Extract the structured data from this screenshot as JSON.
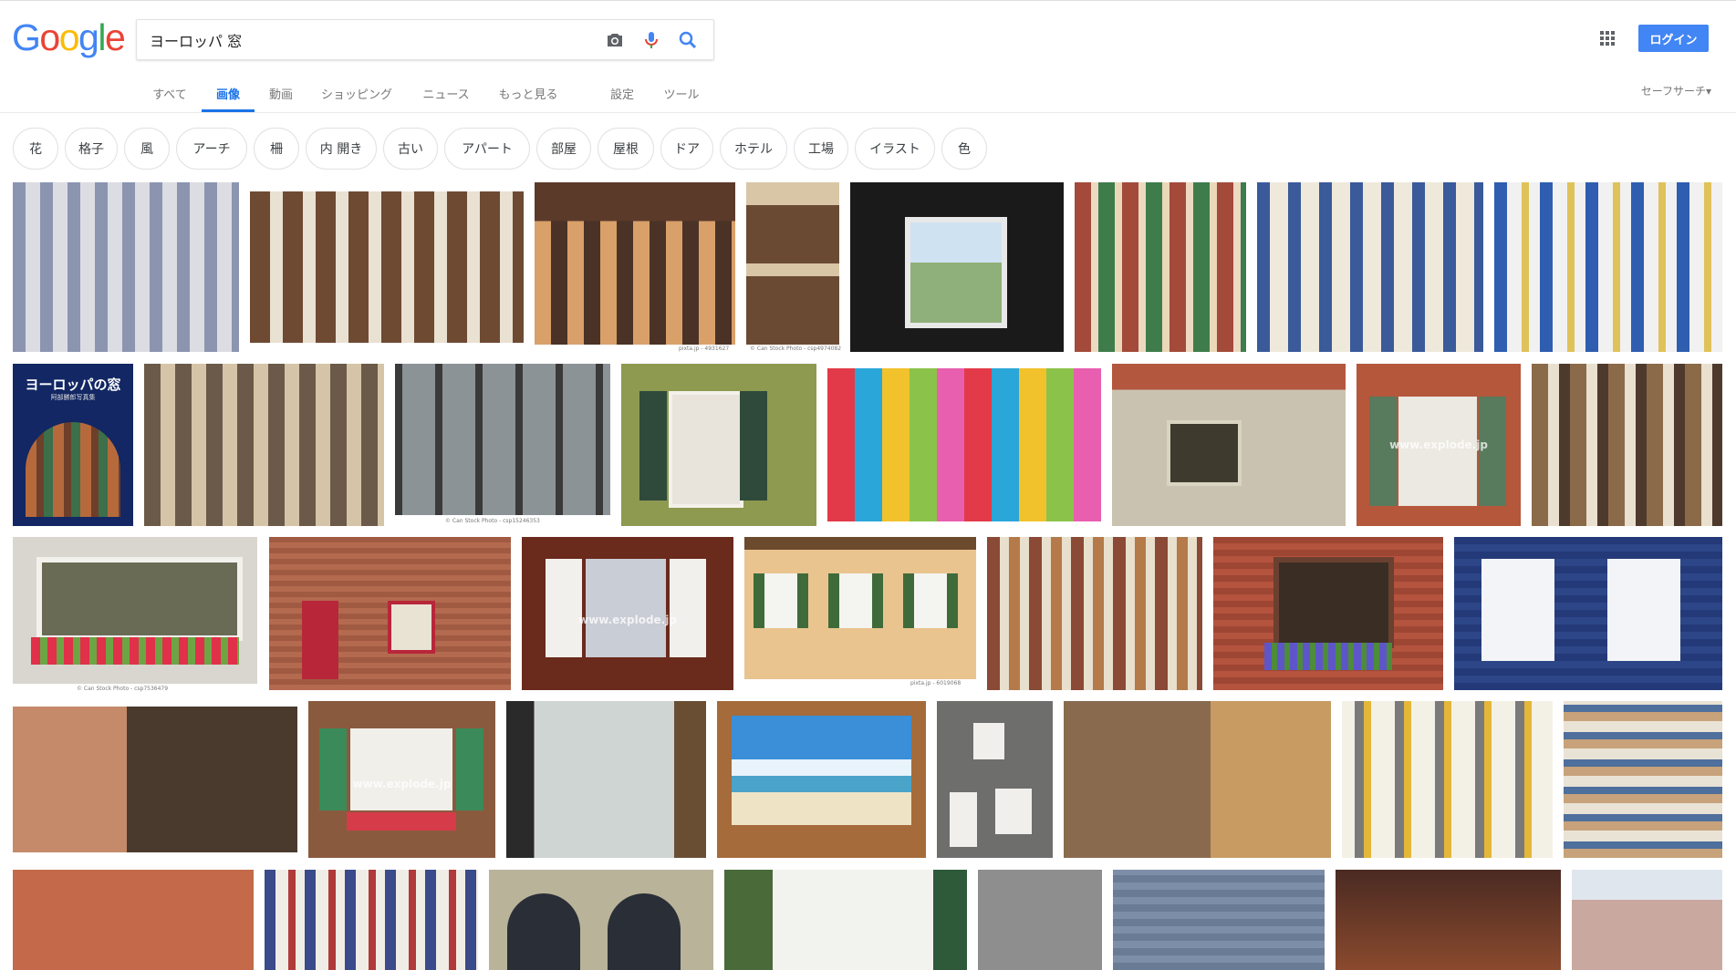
{
  "logo": {
    "letters": [
      "G",
      "o",
      "o",
      "g",
      "l",
      "e"
    ],
    "colors": [
      "#4285f4",
      "#ea4335",
      "#fbbc05",
      "#4285f4",
      "#34a853",
      "#ea4335"
    ]
  },
  "search": {
    "value": "ヨーロッパ 窓"
  },
  "header": {
    "login_label": "ログイン",
    "safesearch_label": "セーフサーチ▾"
  },
  "tabs": [
    {
      "label": "すべて"
    },
    {
      "label": "画像"
    },
    {
      "label": "動画"
    },
    {
      "label": "ショッピング"
    },
    {
      "label": "ニュース"
    },
    {
      "label": "もっと見る"
    },
    {
      "label": "設定"
    },
    {
      "label": "ツール"
    }
  ],
  "active_tab": "画像",
  "chips": [
    "花",
    "格子",
    "風",
    "アーチ",
    "柵",
    "内 開き",
    "古い",
    "アパート",
    "部屋",
    "屋根",
    "ドア",
    "ホテル",
    "工場",
    "イラスト",
    "色"
  ],
  "captions": {
    "pixta1": "pixta.jp - 4931627",
    "canstock1": "© Can Stock Photo - csp4974082",
    "canstock2": "© Can Stock Photo - csp15246353",
    "canstock3": "© Can Stock Photo - csp7536479",
    "pixta2": "pixta.jp - 6019068"
  },
  "book": {
    "title": "ヨーロッパの窓",
    "subtitle": "阿部勝郎写真集"
  },
  "watermarks": {
    "explode": "www.explode.jp"
  },
  "accent_color": "#1a73e8"
}
